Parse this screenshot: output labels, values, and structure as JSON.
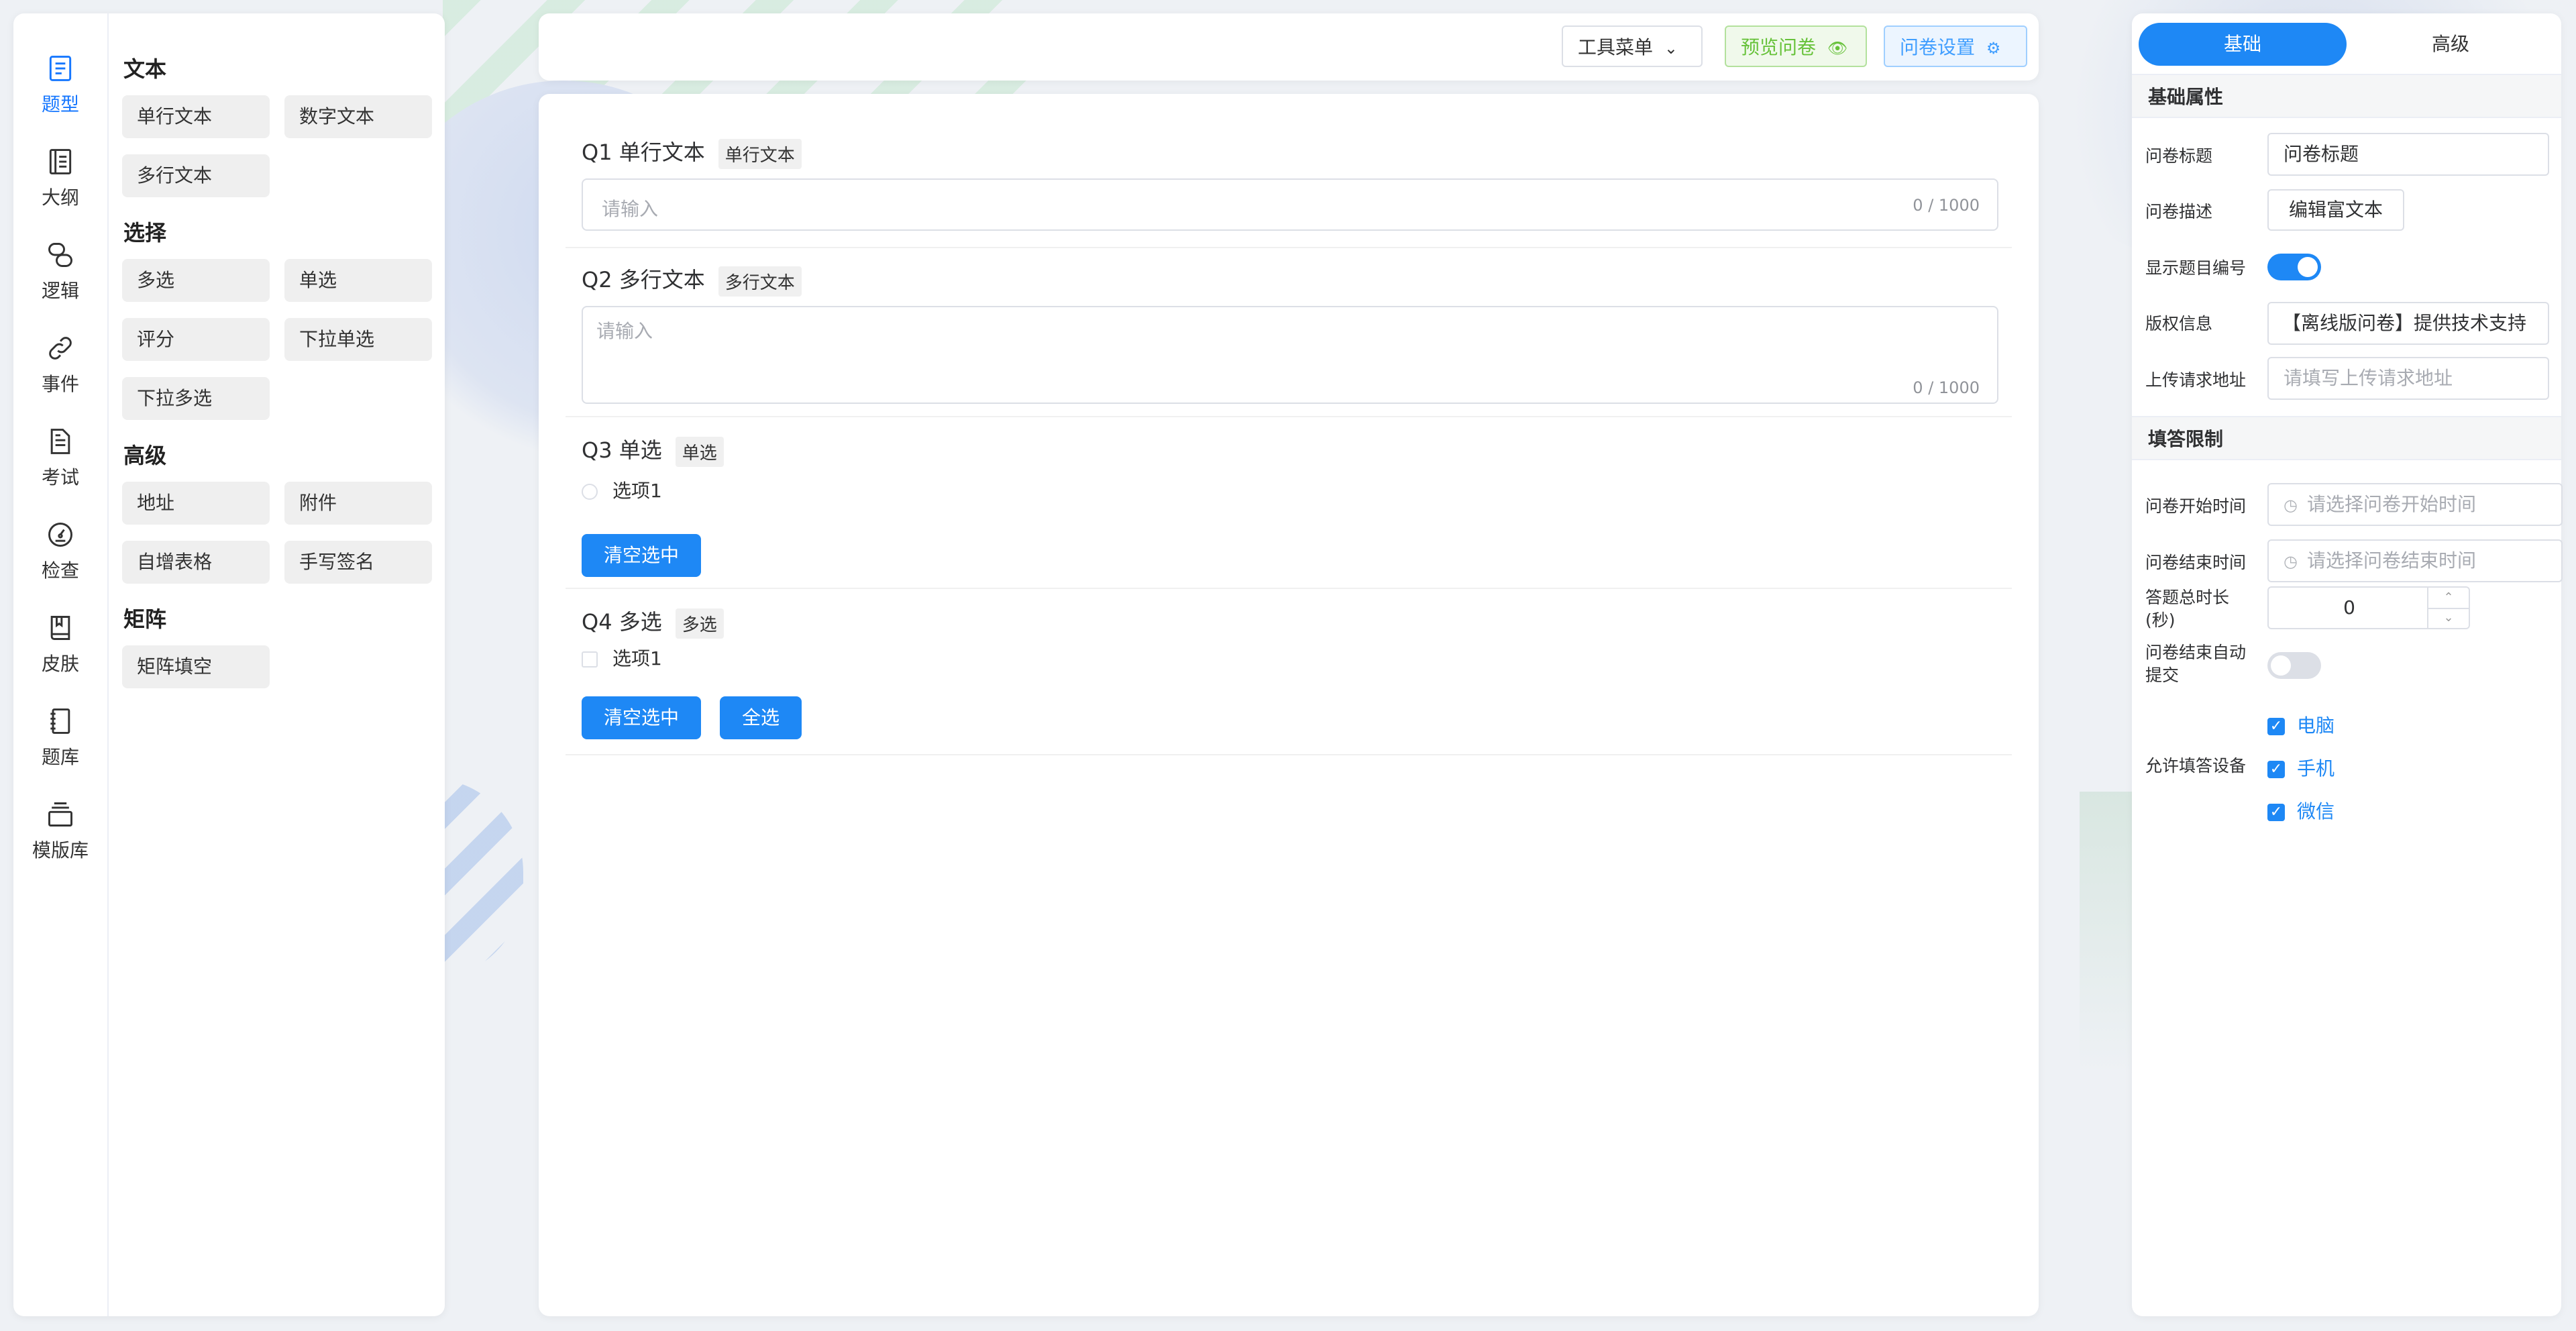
{
  "rail": [
    {
      "label": "题型",
      "icon": "question-type-icon",
      "active": true
    },
    {
      "label": "大纲",
      "icon": "outline-icon"
    },
    {
      "label": "逻辑",
      "icon": "logic-icon"
    },
    {
      "label": "事件",
      "icon": "link-icon"
    },
    {
      "label": "考试",
      "icon": "exam-icon"
    },
    {
      "label": "检查",
      "icon": "gauge-icon"
    },
    {
      "label": "皮肤",
      "icon": "book-icon"
    },
    {
      "label": "题库",
      "icon": "notebook-icon"
    },
    {
      "label": "模版库",
      "icon": "stack-icon"
    }
  ],
  "components": {
    "text": {
      "title": "文本",
      "items": [
        "单行文本",
        "数字文本",
        "多行文本"
      ]
    },
    "choice": {
      "title": "选择",
      "items": [
        "多选",
        "单选",
        "评分",
        "下拉单选",
        "下拉多选"
      ]
    },
    "advanced": {
      "title": "高级",
      "items": [
        "地址",
        "附件",
        "自增表格",
        "手写签名"
      ]
    },
    "matrix": {
      "title": "矩阵",
      "items": [
        "矩阵填空"
      ]
    }
  },
  "toolbar": {
    "tools_label": "工具菜单",
    "preview_label": "预览问卷",
    "settings_label": "问卷设置"
  },
  "questions": {
    "q1": {
      "title": "Q1 单行文本",
      "tag": "单行文本",
      "placeholder": "请输入",
      "counter": "0 / 1000"
    },
    "q2": {
      "title": "Q2 多行文本",
      "tag": "多行文本",
      "placeholder": "请输入",
      "counter": "0 / 1000"
    },
    "q3": {
      "title": "Q3 单选",
      "tag": "单选",
      "option": "选项1",
      "clear_label": "清空选中"
    },
    "q4": {
      "title": "Q4 多选",
      "tag": "多选",
      "option": "选项1",
      "clear_label": "清空选中",
      "select_all_label": "全选"
    }
  },
  "settings": {
    "tab_basic": "基础",
    "tab_advanced": "高级",
    "basic_section": "基础属性",
    "title_label": "问卷标题",
    "title_value": "问卷标题",
    "desc_label": "问卷描述",
    "desc_button": "编辑富文本",
    "show_number_label": "显示题目编号",
    "show_number_on": true,
    "copyright_label": "版权信息",
    "copyright_value": "【离线版问卷】提供技术支持",
    "upload_label": "上传请求地址",
    "upload_placeholder": "请填写上传请求地址",
    "limit_section": "填答限制",
    "start_label": "问卷开始时间",
    "start_placeholder": "请选择问卷开始时间",
    "end_label": "问卷结束时间",
    "end_placeholder": "请选择问卷结束时间",
    "duration_label": "答题总时长(秒)",
    "duration_value": "0",
    "auto_submit_label": "问卷结束自动提交",
    "auto_submit_on": false,
    "devices_label": "允许填答设备",
    "devices": [
      "电脑",
      "手机",
      "微信"
    ]
  },
  "colors": {
    "accent": "#1e88f5",
    "success": "#67c23a",
    "info": "#409eff"
  }
}
